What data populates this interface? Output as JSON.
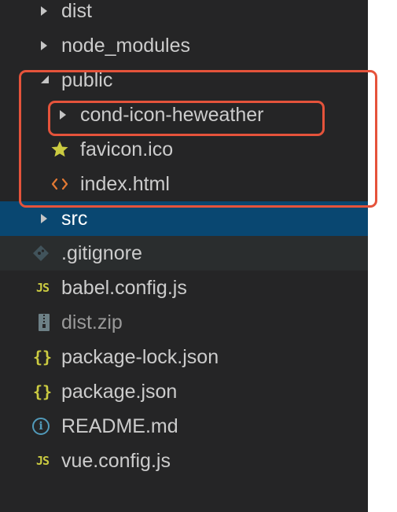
{
  "explorer": {
    "items": [
      {
        "label": "dist",
        "icon": "chevron-right-icon"
      },
      {
        "label": "node_modules",
        "icon": "chevron-right-icon"
      },
      {
        "label": "public",
        "icon": "chevron-down-icon"
      },
      {
        "label": "cond-icon-heweather",
        "icon": "chevron-right-icon"
      },
      {
        "label": "favicon.ico",
        "icon": "star-icon"
      },
      {
        "label": "index.html",
        "icon": "code-brackets-icon"
      },
      {
        "label": "src",
        "icon": "chevron-right-icon"
      },
      {
        "label": ".gitignore",
        "icon": "git-diamond-icon"
      },
      {
        "label": "babel.config.js",
        "icon": "js-file-icon",
        "icon_text": "JS"
      },
      {
        "label": "dist.zip",
        "icon": "zip-archive-icon"
      },
      {
        "label": "package-lock.json",
        "icon": "json-braces-icon",
        "icon_text": "{}"
      },
      {
        "label": "package.json",
        "icon": "json-braces-icon",
        "icon_text": "{}"
      },
      {
        "label": "README.md",
        "icon": "info-icon",
        "icon_text": "i"
      },
      {
        "label": "vue.config.js",
        "icon": "js-file-icon",
        "icon_text": "JS"
      }
    ]
  },
  "colors": {
    "background": "#252526",
    "text": "#cccccc",
    "selected_background": "#094771",
    "hover_background": "#2a2d2e",
    "highlight_border": "#e5533b",
    "js_yellow": "#cbcb41",
    "html_orange": "#e37933",
    "info_blue": "#519aba"
  }
}
